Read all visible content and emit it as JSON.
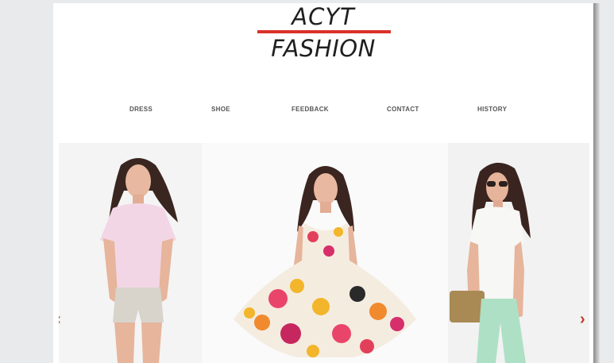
{
  "logo": {
    "line1": "ACYT",
    "line2": "FASHION",
    "bar_color": "#d9322a"
  },
  "nav": {
    "items": [
      {
        "label": "DRESS"
      },
      {
        "label": "SHOE"
      },
      {
        "label": "FEEDBACK"
      },
      {
        "label": "CONTACT"
      },
      {
        "label": "HISTORY"
      }
    ]
  },
  "slider": {
    "prev_icon": "chevron-left-icon",
    "next_icon": "chevron-right-icon",
    "prev_glyph": "‹",
    "next_glyph": "›",
    "accent": "#c0392b",
    "images": [
      {
        "name": "model-pink-blouse"
      },
      {
        "name": "model-floral-dress"
      },
      {
        "name": "model-white-blouse-mint-pants"
      }
    ]
  }
}
